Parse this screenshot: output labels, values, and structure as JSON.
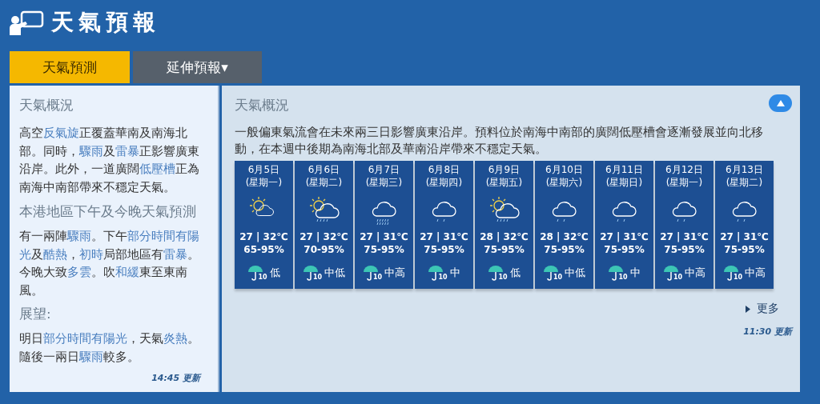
{
  "header": {
    "title": "天氣預報"
  },
  "tabs": [
    {
      "label": "天氣預測",
      "selected": true
    },
    {
      "label": "延伸預報▾",
      "selected": false
    }
  ],
  "local": {
    "title": "天氣概況",
    "summary": [
      {
        "text": "高空",
        "highlight": false
      },
      {
        "text": "反氣旋",
        "highlight": true
      },
      {
        "text": "正覆蓋華南及南海北部。同時，",
        "highlight": false
      },
      {
        "text": "驟雨",
        "highlight": true
      },
      {
        "text": "及",
        "highlight": false
      },
      {
        "text": "雷暴",
        "highlight": true
      },
      {
        "text": "正影響廣東沿岸。此外，一道廣闊",
        "highlight": false
      },
      {
        "text": "低壓槽",
        "highlight": true
      },
      {
        "text": "正為南海中南部帶來不穩定天氣。",
        "highlight": false
      }
    ],
    "forecast_title": "本港地區下午及今晚天氣預測",
    "forecast": [
      {
        "text": "有一兩陣",
        "highlight": false
      },
      {
        "text": "驟雨",
        "highlight": true
      },
      {
        "text": "。下午",
        "highlight": false
      },
      {
        "text": "部分時間有陽光",
        "highlight": true
      },
      {
        "text": "及",
        "highlight": false
      },
      {
        "text": "酷熱",
        "highlight": true
      },
      {
        "text": "，",
        "highlight": false
      },
      {
        "text": "初時",
        "highlight": true
      },
      {
        "text": "局部地區有",
        "highlight": false
      },
      {
        "text": "雷暴",
        "highlight": true
      },
      {
        "text": "。今晚大致",
        "highlight": false
      },
      {
        "text": "多雲",
        "highlight": true
      },
      {
        "text": "。吹",
        "highlight": false
      },
      {
        "text": "和緩",
        "highlight": true
      },
      {
        "text": "東至東南風。",
        "highlight": false
      }
    ],
    "outlook_title": "展望:",
    "outlook": [
      {
        "text": "明日",
        "highlight": false
      },
      {
        "text": "部分時間有陽光",
        "highlight": true
      },
      {
        "text": "，天氣",
        "highlight": false
      },
      {
        "text": "炎熱",
        "highlight": true
      },
      {
        "text": "。隨後一兩日",
        "highlight": false
      },
      {
        "text": "驟雨",
        "highlight": true
      },
      {
        "text": "較多。",
        "highlight": false
      }
    ],
    "updated": "14:45 更新"
  },
  "extended": {
    "title": "天氣概況",
    "summary": "一般偏東氣流會在未來兩三日影響廣東沿岸。預料位於南海中南部的廣闊低壓槽會逐漸發展並向北移動，在本週中後期為南海北部及華南沿岸帶來不穩定天氣。",
    "days": [
      {
        "date": "6月5日",
        "weekday": "(星期一)",
        "kind": "sun-cloud",
        "temp": "27 | 32℃",
        "humidity": "65-95%",
        "psr_badge": "10",
        "psr": "低"
      },
      {
        "date": "6月6日",
        "weekday": "(星期二)",
        "kind": "sun-rain",
        "temp": "27 | 32℃",
        "humidity": "70-95%",
        "psr_badge": "10",
        "psr": "中低"
      },
      {
        "date": "6月7日",
        "weekday": "(星期三)",
        "kind": "heavy-rain",
        "temp": "27 | 31℃",
        "humidity": "75-95%",
        "psr_badge": "10",
        "psr": "中高"
      },
      {
        "date": "6月8日",
        "weekday": "(星期四)",
        "kind": "rain",
        "temp": "27 | 31℃",
        "humidity": "75-95%",
        "psr_badge": "10",
        "psr": "中"
      },
      {
        "date": "6月9日",
        "weekday": "(星期五)",
        "kind": "sun-rain",
        "temp": "28 | 32℃",
        "humidity": "75-95%",
        "psr_badge": "10",
        "psr": "低"
      },
      {
        "date": "6月10日",
        "weekday": "(星期六)",
        "kind": "rain",
        "temp": "28 | 32℃",
        "humidity": "75-95%",
        "psr_badge": "10",
        "psr": "中低"
      },
      {
        "date": "6月11日",
        "weekday": "(星期日)",
        "kind": "rain",
        "temp": "27 | 31℃",
        "humidity": "75-95%",
        "psr_badge": "10",
        "psr": "中"
      },
      {
        "date": "6月12日",
        "weekday": "(星期一)",
        "kind": "rain",
        "temp": "27 | 31℃",
        "humidity": "75-95%",
        "psr_badge": "10",
        "psr": "中高"
      },
      {
        "date": "6月13日",
        "weekday": "(星期二)",
        "kind": "rain",
        "temp": "27 | 31℃",
        "humidity": "75-95%",
        "psr_badge": "10",
        "psr": "中高"
      }
    ],
    "more": "更多",
    "updated": "11:30 更新"
  }
}
